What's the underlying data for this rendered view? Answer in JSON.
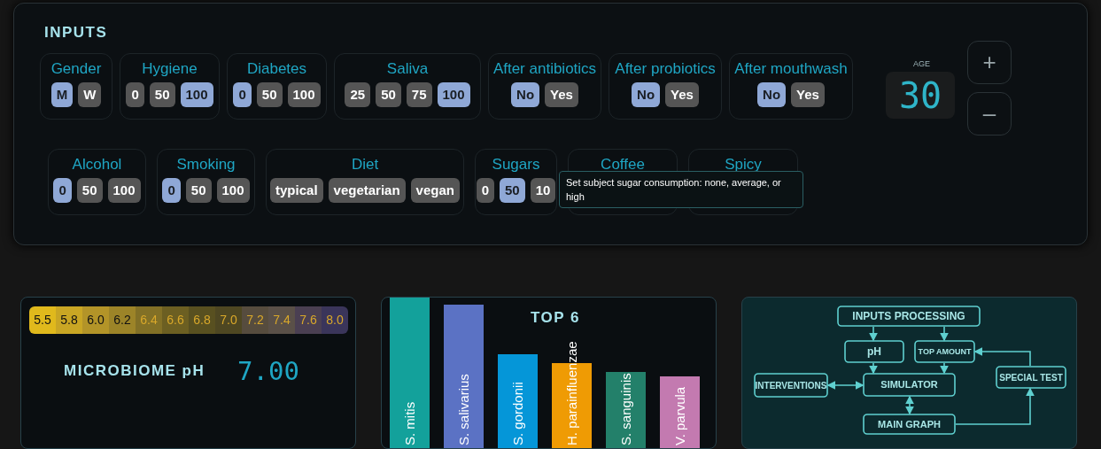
{
  "inputs": {
    "title": "INPUTS",
    "upper_groups": [
      {
        "label": "Gender",
        "options": [
          {
            "text": "M",
            "selected": true
          },
          {
            "text": "W",
            "selected": false
          }
        ]
      },
      {
        "label": "Hygiene",
        "options": [
          {
            "text": "0",
            "selected": false
          },
          {
            "text": "50",
            "selected": false
          },
          {
            "text": "100",
            "selected": true
          }
        ]
      },
      {
        "label": "Diabetes",
        "options": [
          {
            "text": "0",
            "selected": true
          },
          {
            "text": "50",
            "selected": false
          },
          {
            "text": "100",
            "selected": false
          }
        ]
      },
      {
        "label": "Saliva",
        "options": [
          {
            "text": "25",
            "selected": false
          },
          {
            "text": "50",
            "selected": false
          },
          {
            "text": "75",
            "selected": false
          },
          {
            "text": "100",
            "selected": true
          }
        ]
      },
      {
        "label": "After antibiotics",
        "options": [
          {
            "text": "No",
            "selected": true
          },
          {
            "text": "Yes",
            "selected": false
          }
        ]
      },
      {
        "label": "After probiotics",
        "options": [
          {
            "text": "No",
            "selected": true
          },
          {
            "text": "Yes",
            "selected": false
          }
        ]
      },
      {
        "label": "After mouthwash",
        "options": [
          {
            "text": "No",
            "selected": true
          },
          {
            "text": "Yes",
            "selected": false
          }
        ]
      }
    ],
    "lower_groups": [
      {
        "label": "Alcohol",
        "options": [
          {
            "text": "0",
            "selected": true
          },
          {
            "text": "50",
            "selected": false
          },
          {
            "text": "100",
            "selected": false
          }
        ]
      },
      {
        "label": "Smoking",
        "options": [
          {
            "text": "0",
            "selected": true
          },
          {
            "text": "50",
            "selected": false
          },
          {
            "text": "100",
            "selected": false
          }
        ]
      },
      {
        "label": "Diet",
        "options": [
          {
            "text": "typical",
            "selected": false
          },
          {
            "text": "vegetarian",
            "selected": false
          },
          {
            "text": "vegan",
            "selected": false
          }
        ]
      },
      {
        "label": "Sugars",
        "options": [
          {
            "text": "0",
            "selected": false
          },
          {
            "text": "50",
            "selected": true
          },
          {
            "text": "10",
            "selected": false
          }
        ]
      },
      {
        "label": "Coffee"
      },
      {
        "label": "Spicy"
      }
    ],
    "age": {
      "label": "AGE",
      "value": "30",
      "increment": "+",
      "decrement": "–"
    },
    "tooltip": "Set subject sugar consumption: none, average, or high"
  },
  "ph": {
    "scale": [
      {
        "text": "5.5",
        "color": "#e0b91c"
      },
      {
        "text": "5.8",
        "color": "#c9a624"
      },
      {
        "text": "6.0",
        "color": "#b39428"
      },
      {
        "text": "6.2",
        "color": "#9c8428"
      },
      {
        "text": "6.4",
        "color": "#827026"
      },
      {
        "text": "6.6",
        "color": "#6c5f22"
      },
      {
        "text": "6.8",
        "color": "#585020"
      },
      {
        "text": "7.0",
        "color": "#4e4722"
      },
      {
        "text": "7.2",
        "color": "#564c3e"
      },
      {
        "text": "7.4",
        "color": "#5a5048"
      },
      {
        "text": "7.6",
        "color": "#4a3f52"
      },
      {
        "text": "8.0",
        "color": "#3a355a"
      }
    ],
    "label": "MICROBIOME pH",
    "value": "7.00"
  },
  "top": {
    "title": "TOP 6",
    "bars": [
      {
        "label": "S. mitis",
        "color": "#13a19b"
      },
      {
        "label": "S. salivarius",
        "color": "#5b72c4"
      },
      {
        "label": "S. gordonii",
        "color": "#0596d8"
      },
      {
        "label": "H. parainfluenzae",
        "color": "#ef9b04"
      },
      {
        "label": "S. sanguinis",
        "color": "#23806a"
      },
      {
        "label": "V. parvula",
        "color": "#c37ab0"
      }
    ]
  },
  "diagram": {
    "nodes": [
      "INPUTS PROCESSING",
      "pH",
      "TOP AMOUNT",
      "INTERVENTIONS",
      "SIMULATOR",
      "SPECIAL TEST",
      "MAIN GRAPH"
    ]
  }
}
